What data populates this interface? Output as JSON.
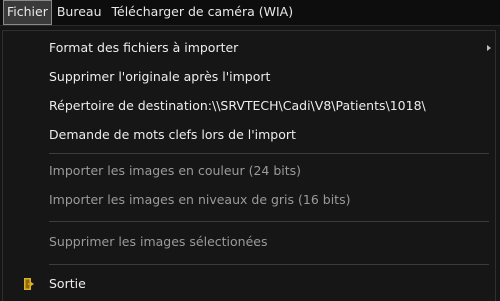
{
  "menubar": {
    "items": [
      {
        "label": "Fichier"
      },
      {
        "label": "Bureau"
      },
      {
        "label": "Télécharger de caméra (WIA)"
      }
    ]
  },
  "menu": {
    "items": [
      {
        "label": "Format des fichiers à importer",
        "has_submenu": true
      },
      {
        "label": "Supprimer l'originale après l'import"
      },
      {
        "label": "Répertoire de destination:\\\\SRVTECH\\Cadi\\V8\\Patients\\1018\\"
      },
      {
        "label": "Demande de mots clefs lors de l'import"
      },
      {
        "label": "Importer les images en couleur (24 bits)"
      },
      {
        "label": "Importer les images en niveaux de gris (16 bits)"
      },
      {
        "label": "Supprimer les images sélectionées"
      },
      {
        "label": "Sortie",
        "icon": "exit-door-icon"
      }
    ]
  },
  "colors": {
    "menu_background": "#161616",
    "text": "#ededed",
    "disabled_text": "#9a9a9a",
    "exit_icon": "#e0b020"
  }
}
